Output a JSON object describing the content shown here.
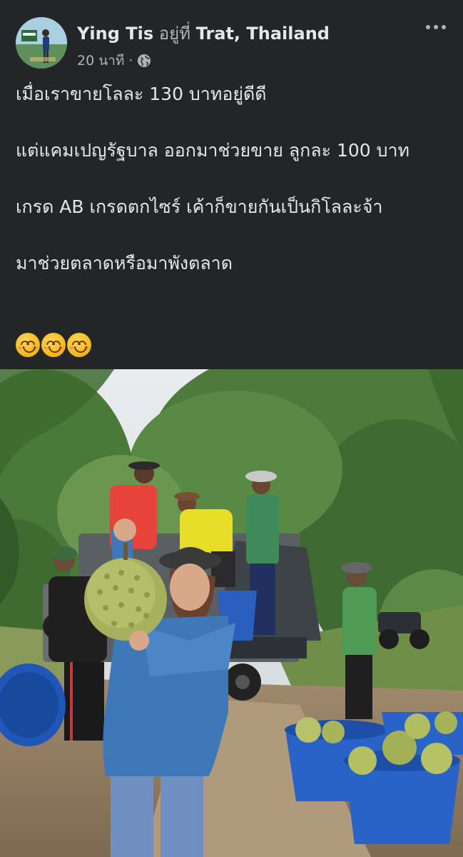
{
  "post": {
    "author": "Ying Tis",
    "location_prefix": "อยู่ที่",
    "location": "Trat, Thailand",
    "time": "20 นาที",
    "separator": "·",
    "paragraphs": [
      "เมื่อเราขายโลละ 130 บาทอยู่ดีดี",
      "แต่แคมเปญรัฐบาล ออกมาช่วยขาย ลูกละ 100 บาท",
      "เกรด AB เกรดตกไซร์ เค้าก็ขายกันเป็นกิโลละจ้า",
      "มาช่วยตลาดหรือมาพังตลาด"
    ],
    "emoji_count": 3,
    "emoji": "smiling-face-with-smiling-eyes"
  },
  "colors": {
    "background": "#242526",
    "primary_text": "#e4e6eb",
    "secondary_text": "#b0b3b8"
  },
  "icons": {
    "privacy": "globe-icon",
    "menu": "more-horizontal-icon"
  }
}
